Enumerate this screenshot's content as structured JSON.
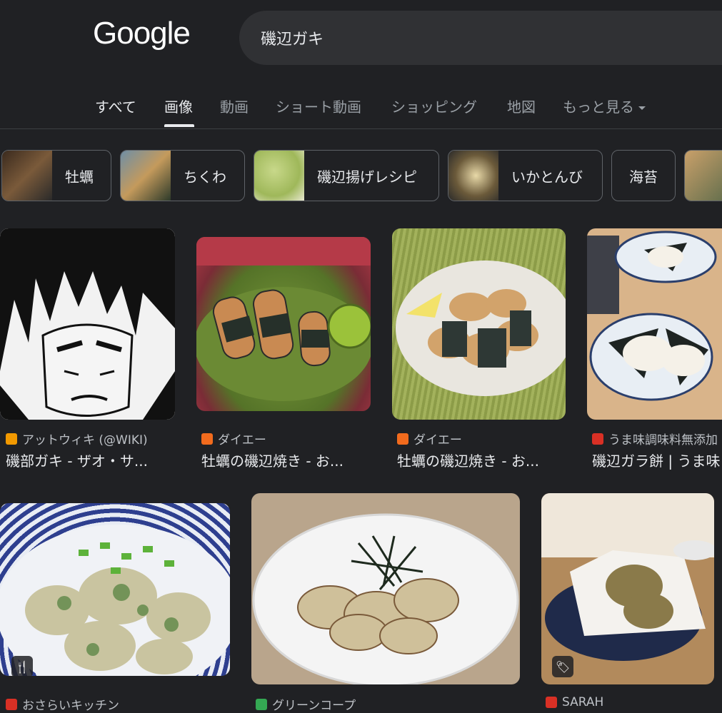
{
  "logo": "Google",
  "search": {
    "query": "磯辺ガキ"
  },
  "tabs": [
    {
      "label": "すべて"
    },
    {
      "label": "画像"
    },
    {
      "label": "動画"
    },
    {
      "label": "ショート動画"
    },
    {
      "label": "ショッピング"
    },
    {
      "label": "地図"
    },
    {
      "label": "もっと見る"
    }
  ],
  "chips": [
    {
      "label": "牡蠣"
    },
    {
      "label": "ちくわ"
    },
    {
      "label": "磯辺揚げレシピ"
    },
    {
      "label": "いかとんび"
    },
    {
      "label": "海苔"
    }
  ],
  "results": [
    {
      "source": "アットウィキ (@WIKI)",
      "title": "磯部ガキ - ザオ・サ...",
      "fav_color": "#f29900"
    },
    {
      "source": "ダイエー",
      "title": "牡蠣の磯辺焼き - お...",
      "fav_color": "#f26b1d"
    },
    {
      "source": "ダイエー",
      "title": "牡蠣の磯辺焼き - お...",
      "fav_color": "#f26b1d"
    },
    {
      "source": "うま味調味料無添加",
      "title": "磯辺ガラ餅 | うま味",
      "fav_color": "#d93025"
    },
    {
      "source": "おさらいキッチン",
      "title": "",
      "fav_color": "#d93025"
    },
    {
      "source": "グリーンコープ",
      "title": "",
      "fav_color": "#34a853"
    },
    {
      "source": "SARAH",
      "title": "",
      "fav_color": "#d93025"
    }
  ],
  "badges": {
    "recipe_icon": "fork-knife-icon",
    "product_icon": "tag-icon"
  },
  "colors": {
    "background": "#202124",
    "searchbox": "#303134",
    "text": "#e8eaed",
    "muted": "#9aa0a6"
  }
}
